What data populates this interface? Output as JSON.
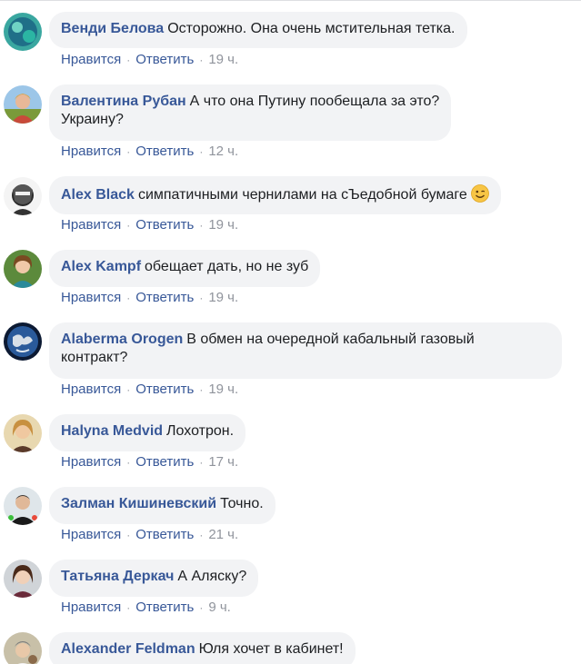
{
  "labels": {
    "like": "Нравится",
    "reply": "Ответить",
    "separator": "·"
  },
  "comments": [
    {
      "author": "Венди Белова",
      "text": "Осторожно. Она очень мстительная тетка.",
      "time": "19 ч.",
      "avatar_icon": "avatar-photo"
    },
    {
      "author": "Валентина Рубан",
      "text": "А что она Путину пообещала за это?",
      "text2": "Украину?",
      "time": "12 ч.",
      "avatar_icon": "avatar-photo"
    },
    {
      "author": "Alex Black",
      "text": "симпатичными чернилами на сЪедобной бумаге",
      "time": "19 ч.",
      "avatar_icon": "avatar-photo",
      "emoji": "wink-smile-emoji"
    },
    {
      "author": "Alex Kampf",
      "text": "обещает дать, но не зуб",
      "time": "19 ч.",
      "avatar_icon": "avatar-photo"
    },
    {
      "author": "Alaberma Orogen",
      "text": "В обмен на очередной кабальный газовый",
      "text2": "контракт?",
      "time": "19 ч.",
      "avatar_icon": "avatar-photo"
    },
    {
      "author": "Halyna Medvid",
      "text": "Лохотрон.",
      "time": "17 ч.",
      "avatar_icon": "avatar-photo"
    },
    {
      "author": "Залман Кишиневский",
      "text": "Точно.",
      "time": "21 ч.",
      "avatar_icon": "avatar-photo"
    },
    {
      "author": "Татьяна Деркач",
      "text": "А Аляску?",
      "time": "9 ч.",
      "avatar_icon": "avatar-photo"
    },
    {
      "author": "Alexander Feldman",
      "text": "Юля хочет в кабинет!",
      "avatar_icon": "avatar-photo"
    }
  ],
  "colors": {
    "author": "#385898",
    "bubble": "#f2f3f5",
    "timestamp": "#90949c"
  }
}
